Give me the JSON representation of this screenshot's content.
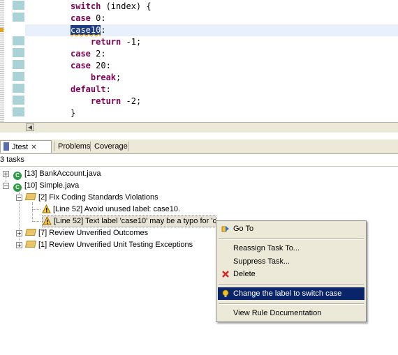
{
  "editor": {
    "lines": [
      {
        "kw": "switch",
        "rest": " (index) {"
      },
      {
        "kw": "case",
        "rest": " 0:"
      },
      {
        "sel": "case10",
        "rest": ":"
      },
      {
        "indent": "    ",
        "kw": "return",
        "rest": " -1;"
      },
      {
        "kw": "case",
        "rest": " 2:"
      },
      {
        "kw": "case",
        "rest": " 20:"
      },
      {
        "indent": "    ",
        "kw": "break",
        "rest": ";"
      },
      {
        "kw": "default",
        "rest": ":"
      },
      {
        "indent": "    ",
        "kw": "return",
        "rest": " -2;"
      },
      {
        "rest": "}"
      }
    ]
  },
  "tabs": {
    "jtest": "Jtest",
    "problems": "Problems",
    "coverage": "Coverage"
  },
  "status": "3 tasks",
  "tree": {
    "bank_account": "[13] BankAccount.java",
    "simple": "[10] Simple.java",
    "fix_coding": "[2] Fix Coding Standards Violations",
    "line52_unused": "[Line 52] Avoid unused label: case10.",
    "line52_typo": "[Line 52] Text label 'case10' may be a typo for 'case 10'",
    "review_outcomes": "[7] Review Unverified Outcomes",
    "review_exceptions": "[1] Review Unverified Unit Testing Exceptions",
    "class_icon_letter": "C"
  },
  "context_menu": {
    "goto": "Go To",
    "reassign": "Reassign Task To...",
    "suppress": "Suppress Task...",
    "delete": "Delete",
    "change_label": "Change the label to switch case",
    "view_rule": "View Rule Documentation"
  },
  "colors": {
    "keyword": "#7f0055",
    "menu_highlight": "#0a246a",
    "delete_icon": "#d22b2b",
    "quickfix_icon": "#f2c21b"
  }
}
